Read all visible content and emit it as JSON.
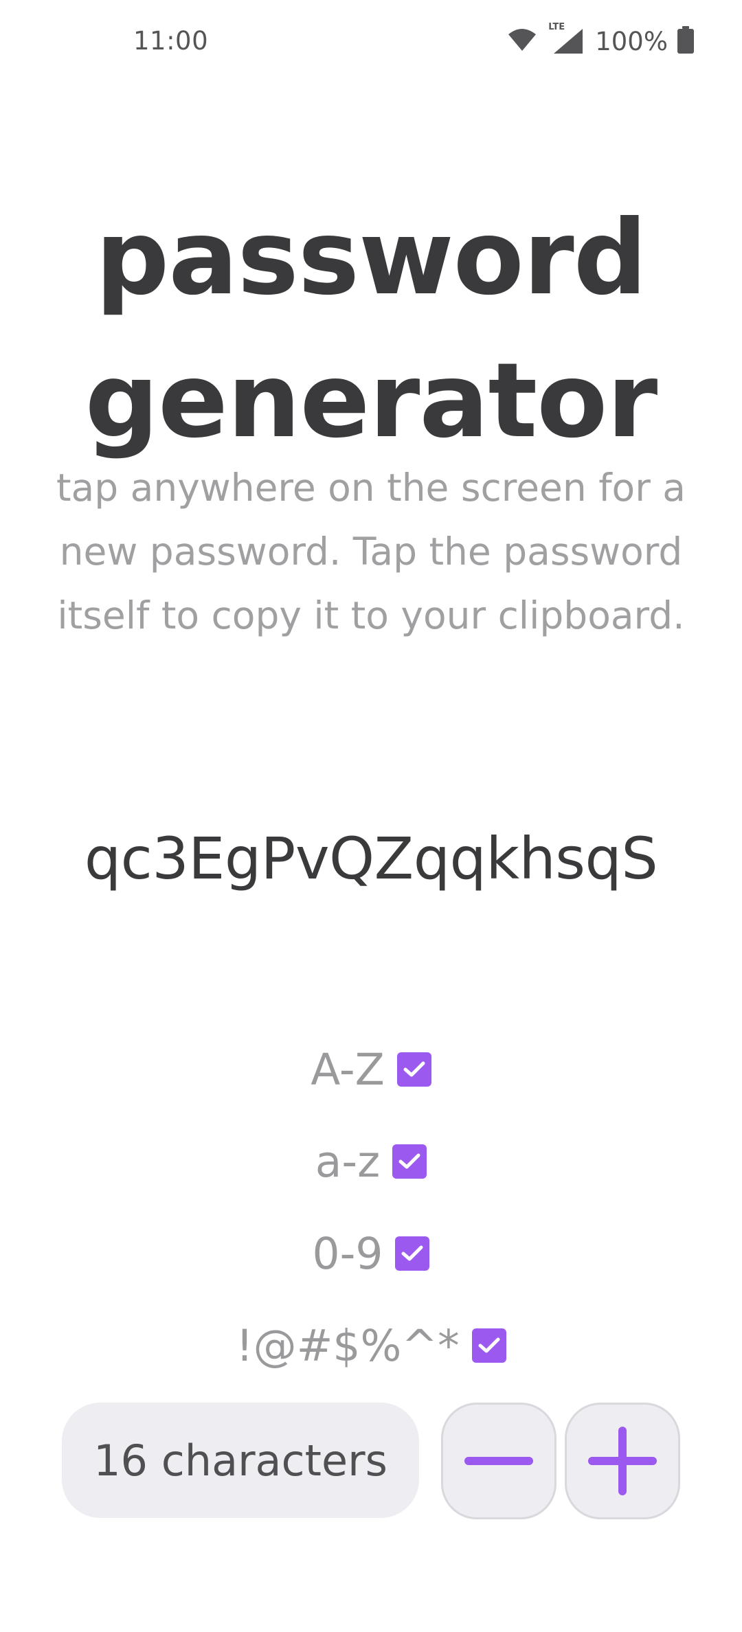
{
  "status_bar": {
    "time": "11:00",
    "battery": "100%",
    "icons": [
      "wifi-icon",
      "lte-signal-icon",
      "battery-icon"
    ],
    "network_label": "LTE"
  },
  "title": "password generator",
  "instructions": "tap anywhere on the screen for a new password. Tap the password itself to copy it to your clipboard.",
  "password": "qc3EgPvQZqqkhsqS",
  "options": [
    {
      "label": "A-Z",
      "checked": true
    },
    {
      "label": "a-z",
      "checked": true
    },
    {
      "label": "0-9",
      "checked": true
    },
    {
      "label": "!@#$%^*",
      "checked": true
    }
  ],
  "length": {
    "label": "16 characters",
    "decrease_icon": "minus-icon",
    "increase_icon": "plus-icon"
  },
  "colors": {
    "accent": "#9b59f0",
    "title_text": "#3a3a3c",
    "muted_text": "#a0a0a3",
    "control_bg": "#eeeef2"
  }
}
